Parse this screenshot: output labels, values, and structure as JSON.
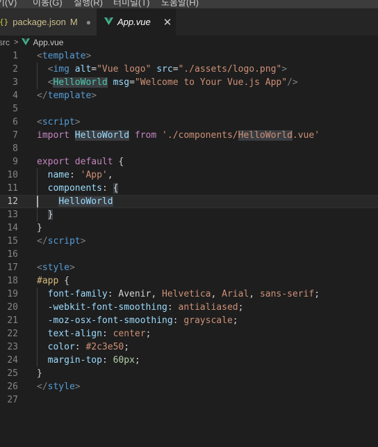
{
  "menubar": {
    "items": [
      "기(V)",
      "이동(G)",
      "실행(R)",
      "터미널(T)",
      "도움말(H)"
    ]
  },
  "tabs": [
    {
      "icon": "{}",
      "label": "package.json",
      "status": "M",
      "dirty": "●"
    },
    {
      "icon": "vue-icon",
      "label": "App.vue",
      "close": "✕"
    }
  ],
  "breadcrumb": {
    "folder": "src",
    "separator": ">",
    "file": "App.vue"
  },
  "editor": {
    "active_line": 12,
    "lines": [
      {
        "n": "1",
        "tokens": [
          [
            "t-punct",
            "<"
          ],
          [
            "t-tag",
            "template"
          ],
          [
            "t-punct",
            ">"
          ]
        ]
      },
      {
        "n": "2",
        "tokens": [
          [
            "t-plain",
            "  "
          ],
          [
            "t-punct",
            "<"
          ],
          [
            "t-tag",
            "img"
          ],
          [
            "t-plain",
            " "
          ],
          [
            "t-attr",
            "alt"
          ],
          [
            "t-plain",
            "="
          ],
          [
            "t-str",
            "\"Vue logo\""
          ],
          [
            "t-plain",
            " "
          ],
          [
            "t-attr",
            "src"
          ],
          [
            "t-plain",
            "="
          ],
          [
            "t-str",
            "\"./assets/logo.png\""
          ],
          [
            "t-punct",
            ">"
          ]
        ]
      },
      {
        "n": "3",
        "tokens": [
          [
            "t-plain",
            "  "
          ],
          [
            "t-punct",
            "<"
          ],
          [
            "t-comp hl",
            "HelloWorld"
          ],
          [
            "t-plain",
            " "
          ],
          [
            "t-attr",
            "msg"
          ],
          [
            "t-plain",
            "="
          ],
          [
            "t-str",
            "\"Welcome to Your Vue.js App\""
          ],
          [
            "t-punct",
            "/>"
          ]
        ]
      },
      {
        "n": "4",
        "tokens": [
          [
            "t-punct",
            "</"
          ],
          [
            "t-tag",
            "template"
          ],
          [
            "t-punct",
            ">"
          ]
        ]
      },
      {
        "n": "5",
        "tokens": []
      },
      {
        "n": "6",
        "tokens": [
          [
            "t-punct",
            "<"
          ],
          [
            "t-tag",
            "script"
          ],
          [
            "t-punct",
            ">"
          ]
        ]
      },
      {
        "n": "7",
        "tokens": [
          [
            "t-kw",
            "import"
          ],
          [
            "t-plain",
            " "
          ],
          [
            "t-prop hl",
            "HelloWorld"
          ],
          [
            "t-plain",
            " "
          ],
          [
            "t-kw",
            "from"
          ],
          [
            "t-plain",
            " "
          ],
          [
            "t-str",
            "'./components/"
          ],
          [
            "t-str hl",
            "HelloWorld"
          ],
          [
            "t-str",
            ".vue'"
          ]
        ]
      },
      {
        "n": "8",
        "tokens": []
      },
      {
        "n": "9",
        "tokens": [
          [
            "t-kw",
            "export"
          ],
          [
            "t-plain",
            " "
          ],
          [
            "t-kw",
            "default"
          ],
          [
            "t-plain",
            " {"
          ]
        ]
      },
      {
        "n": "10",
        "tokens": [
          [
            "t-plain",
            "  "
          ],
          [
            "t-prop",
            "name"
          ],
          [
            "t-plain",
            ": "
          ],
          [
            "t-str",
            "'App'"
          ],
          [
            "t-plain",
            ","
          ]
        ]
      },
      {
        "n": "11",
        "tokens": [
          [
            "t-plain",
            "  "
          ],
          [
            "t-prop",
            "components"
          ],
          [
            "t-plain",
            ": "
          ],
          [
            "t-plain hl",
            "{"
          ]
        ]
      },
      {
        "n": "12",
        "tokens": [
          [
            "t-plain",
            "    "
          ],
          [
            "t-prop hl",
            "HelloWorld"
          ]
        ]
      },
      {
        "n": "13",
        "tokens": [
          [
            "t-plain",
            "  "
          ],
          [
            "t-plain hl",
            "}"
          ]
        ]
      },
      {
        "n": "14",
        "tokens": [
          [
            "t-plain",
            "}"
          ]
        ]
      },
      {
        "n": "15",
        "tokens": [
          [
            "t-punct",
            "</"
          ],
          [
            "t-tag",
            "script"
          ],
          [
            "t-punct",
            ">"
          ]
        ]
      },
      {
        "n": "16",
        "tokens": []
      },
      {
        "n": "17",
        "tokens": [
          [
            "t-punct",
            "<"
          ],
          [
            "t-tag",
            "style"
          ],
          [
            "t-punct",
            ">"
          ]
        ]
      },
      {
        "n": "18",
        "tokens": [
          [
            "t-sel",
            "#app"
          ],
          [
            "t-plain",
            " {"
          ]
        ]
      },
      {
        "n": "19",
        "tokens": [
          [
            "t-plain",
            "  "
          ],
          [
            "t-prop",
            "font-family"
          ],
          [
            "t-plain",
            ": Avenir, "
          ],
          [
            "t-str",
            "Helvetica"
          ],
          [
            "t-plain",
            ", "
          ],
          [
            "t-str",
            "Arial"
          ],
          [
            "t-plain",
            ", "
          ],
          [
            "t-str",
            "sans-serif"
          ],
          [
            "t-plain",
            ";"
          ]
        ]
      },
      {
        "n": "20",
        "tokens": [
          [
            "t-plain",
            "  "
          ],
          [
            "t-prop",
            "-webkit-font-smoothing"
          ],
          [
            "t-plain",
            ": "
          ],
          [
            "t-str",
            "antialiased"
          ],
          [
            "t-plain",
            ";"
          ]
        ]
      },
      {
        "n": "21",
        "tokens": [
          [
            "t-plain",
            "  "
          ],
          [
            "t-prop",
            "-moz-osx-font-smoothing"
          ],
          [
            "t-plain",
            ": "
          ],
          [
            "t-str",
            "grayscale"
          ],
          [
            "t-plain",
            ";"
          ]
        ]
      },
      {
        "n": "22",
        "tokens": [
          [
            "t-plain",
            "  "
          ],
          [
            "t-prop",
            "text-align"
          ],
          [
            "t-plain",
            ": "
          ],
          [
            "t-str",
            "center"
          ],
          [
            "t-plain",
            ";"
          ]
        ]
      },
      {
        "n": "23",
        "tokens": [
          [
            "t-plain",
            "  "
          ],
          [
            "t-prop",
            "color"
          ],
          [
            "t-plain",
            ": "
          ],
          [
            "t-str",
            "#2c3e50"
          ],
          [
            "t-plain",
            ";"
          ]
        ]
      },
      {
        "n": "24",
        "tokens": [
          [
            "t-plain",
            "  "
          ],
          [
            "t-prop",
            "margin-top"
          ],
          [
            "t-plain",
            ": "
          ],
          [
            "t-num",
            "60px"
          ],
          [
            "t-plain",
            ";"
          ]
        ]
      },
      {
        "n": "25",
        "tokens": [
          [
            "t-plain",
            "}"
          ]
        ]
      },
      {
        "n": "26",
        "tokens": [
          [
            "t-punct",
            "</"
          ],
          [
            "t-tag",
            "style"
          ],
          [
            "t-punct",
            ">"
          ]
        ]
      },
      {
        "n": "27",
        "tokens": []
      }
    ]
  },
  "colors": {
    "background": "#1e1e1e",
    "tab_inactive": "#2d2d2d",
    "menubar": "#3c3c3c",
    "vue_green": "#41b883"
  }
}
